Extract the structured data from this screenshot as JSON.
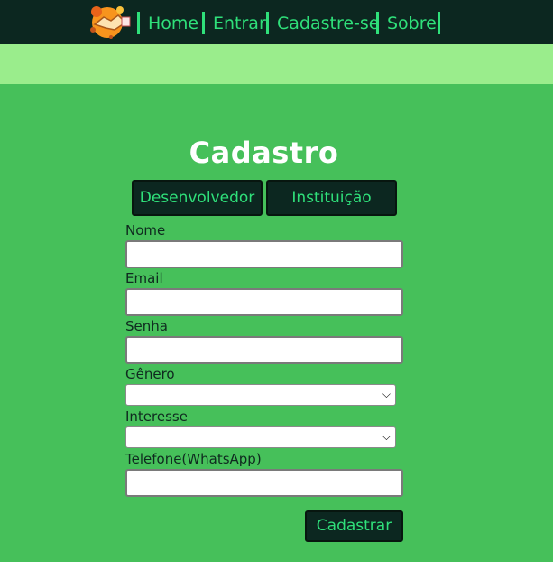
{
  "nav": {
    "logo_icon": "handshake-globe-logo-icon",
    "items": [
      {
        "label": "Home"
      },
      {
        "label": "Entrar"
      },
      {
        "label": "Cadastre-se"
      },
      {
        "label": "Sobre"
      }
    ]
  },
  "form": {
    "title": "Cadastro",
    "tabs": [
      {
        "label": "Desenvolvedor"
      },
      {
        "label": "Instituição"
      }
    ],
    "fields": {
      "nome_label": "Nome",
      "nome_value": "",
      "email_label": "Email",
      "email_value": "",
      "senha_label": "Senha",
      "senha_value": "",
      "genero_label": "Gênero",
      "genero_selected": "",
      "interesse_label": "Interesse",
      "interesse_selected": "",
      "telefone_label": "Telefone(WhatsApp)",
      "telefone_value": ""
    },
    "submit_label": "Cadastrar"
  },
  "colors": {
    "topbar": "#0c2720",
    "nav_accent": "#2fe07a",
    "banner": "#9aed8c",
    "page_bg": "#46c05a",
    "title": "#ffffff"
  }
}
